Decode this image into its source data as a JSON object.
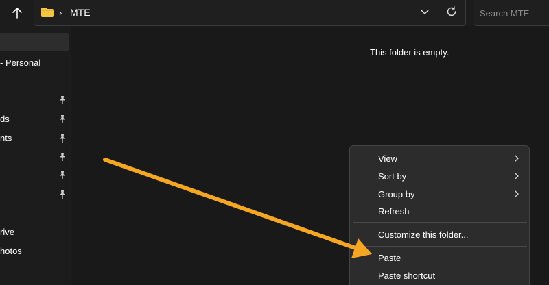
{
  "address_bar": {
    "chevron": "›",
    "path": "MTE"
  },
  "search": {
    "placeholder": "Search MTE"
  },
  "sidebar": {
    "items": [
      {
        "label": "",
        "selected": true
      },
      {
        "label": "- Personal"
      },
      {
        "label": "ds",
        "pinned": true
      },
      {
        "label": "nts",
        "pinned": true
      },
      {
        "label": "rive"
      },
      {
        "label": "hotos"
      }
    ]
  },
  "content": {
    "empty_message": "This folder is empty."
  },
  "context_menu": {
    "items": [
      {
        "label": "View",
        "submenu": true
      },
      {
        "label": "Sort by",
        "submenu": true
      },
      {
        "label": "Group by",
        "submenu": true
      },
      {
        "label": "Refresh"
      },
      {
        "label": "Customize this folder..."
      },
      {
        "label": "Paste"
      },
      {
        "label": "Paste shortcut"
      }
    ]
  },
  "icons": {
    "up": "arrow-up-icon",
    "folder": "folder-icon",
    "dropdown": "chevron-down-icon",
    "refresh": "refresh-icon",
    "pin": "pin-icon",
    "submenu": "chevron-right-icon"
  },
  "colors": {
    "background": "#191919",
    "sidebar": "#1c1c1c",
    "menu": "#2c2c2c",
    "folder": "#f4c542",
    "annotation_arrow": "#f5a623"
  }
}
